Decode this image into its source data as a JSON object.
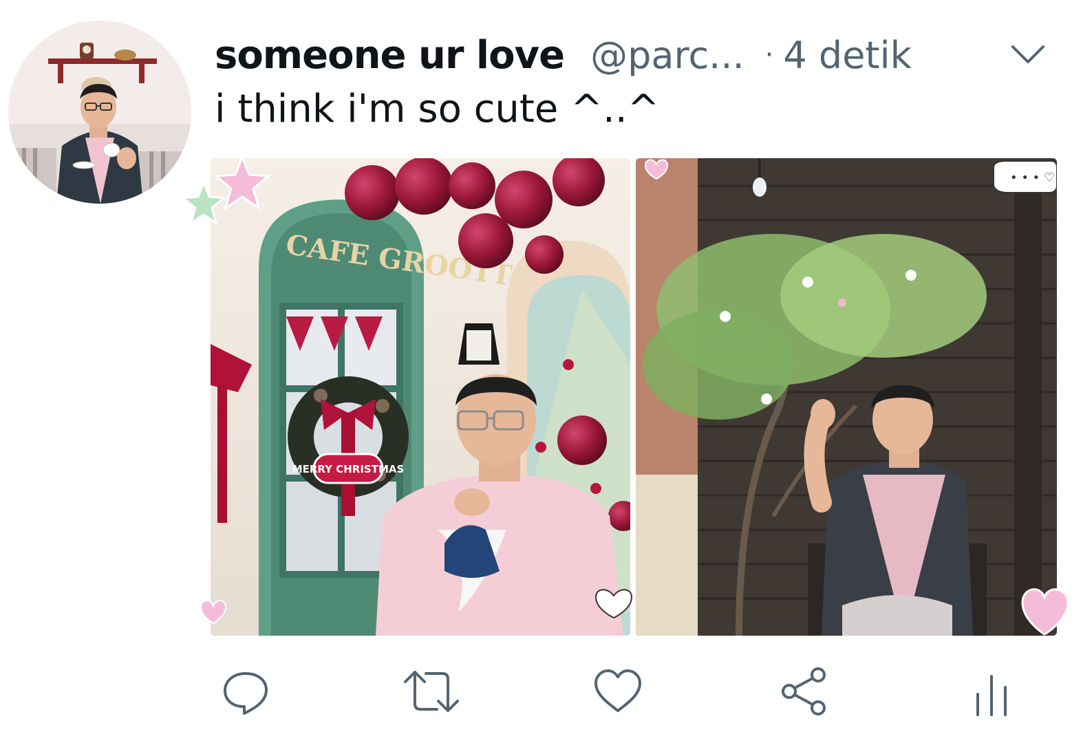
{
  "tweet": {
    "display_name": "someone ur love",
    "handle": "@parc...",
    "separator": "·",
    "timestamp": "4 detik",
    "text": "i think i'm so cute ^..^"
  },
  "media": {
    "left_photo": {
      "sign_text": "CAFE GROOTTO",
      "wreath_banner": "MERRY CHRISTMAS"
    },
    "right_photo": {
      "speech_bubble": "• • • ♡"
    }
  },
  "actions": {
    "reply_icon": "reply-icon",
    "retweet_icon": "retweet-icon",
    "like_icon": "heart-icon",
    "share_icon": "share-icon",
    "analytics_icon": "analytics-icon"
  },
  "colors": {
    "text_primary": "#0f1419",
    "text_secondary": "#536471",
    "icon": "#536471",
    "sticker_pink": "#f5bcd9",
    "sticker_green": "#b9e3c3"
  }
}
